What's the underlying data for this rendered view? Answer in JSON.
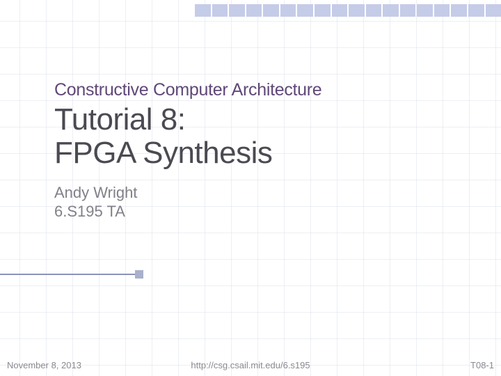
{
  "header": {
    "course_name": "Constructive Computer Architecture",
    "title_line1": "Tutorial 8:",
    "title_line2": "FPGA Synthesis",
    "author": "Andy Wright",
    "course_code": "6.S195 TA"
  },
  "footer": {
    "date": "November 8, 2013",
    "url": "http://csg.csail.mit.edu/6.s195",
    "page": "T08-1"
  }
}
